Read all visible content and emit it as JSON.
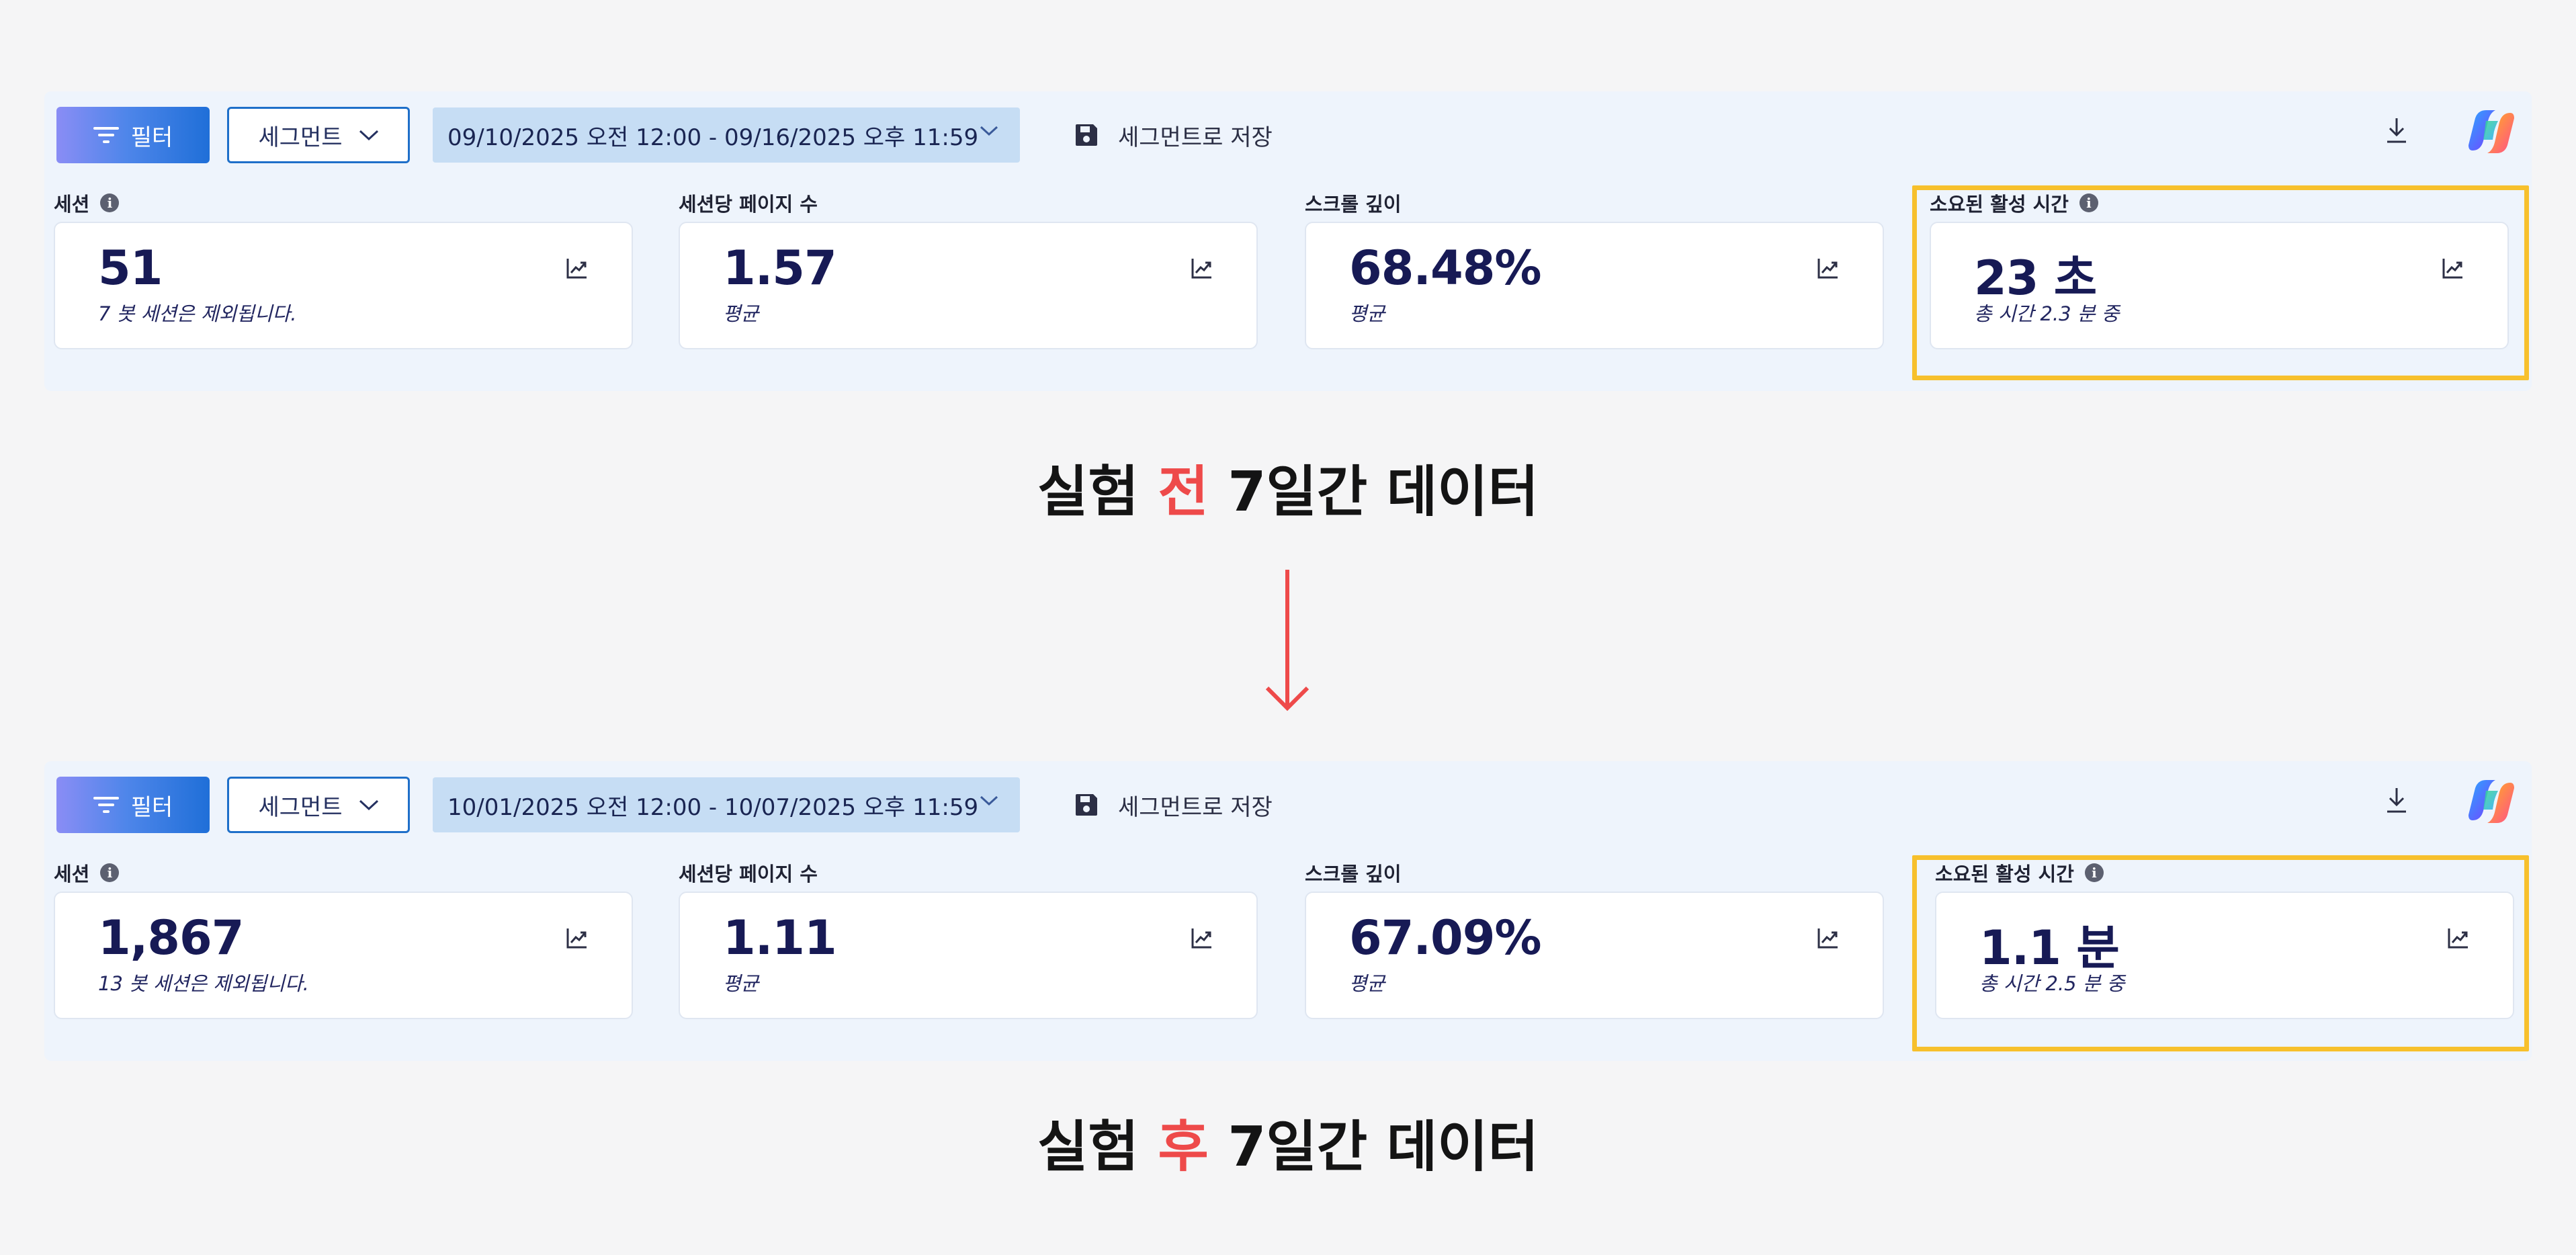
{
  "toolbar": {
    "filter_label": "필터",
    "segment_label": "세그먼트",
    "save_segment_label": "세그먼트로 저장"
  },
  "panels": [
    {
      "date_range": "09/10/2025 오전 12:00 - 09/16/2025 오후 11:59",
      "metrics": [
        {
          "label": "세션",
          "value": "51",
          "sub": "7 봇 세션은 제외됩니다."
        },
        {
          "label": "세션당 페이지 수",
          "value": "1.57",
          "sub": "평균"
        },
        {
          "label": "스크롤 깊이",
          "value": "68.48%",
          "sub": "평균"
        },
        {
          "label": "소요된 활성 시간",
          "value": "23 초",
          "sub": "총 시간 2.3 분 중"
        }
      ],
      "caption": {
        "pre": "실험 ",
        "accent": "전",
        "post": " 7일간 데이터"
      }
    },
    {
      "date_range": "10/01/2025 오전 12:00 - 10/07/2025 오후 11:59",
      "metrics": [
        {
          "label": "세션",
          "value": "1,867",
          "sub": "13 봇 세션은 제외됩니다."
        },
        {
          "label": "세션당 페이지 수",
          "value": "1.11",
          "sub": "평균"
        },
        {
          "label": "스크롤 깊이",
          "value": "67.09%",
          "sub": "평균"
        },
        {
          "label": "소요된 활성 시간",
          "value": "1.1 분",
          "sub": "총 시간 2.5 분 중"
        }
      ],
      "caption": {
        "pre": "실험 ",
        "accent": "후",
        "post": " 7일간 데이터"
      }
    }
  ],
  "colors": {
    "highlight": "#f7c02c",
    "accent_red": "#ee4a4a",
    "panel_bg": "#eef4fc",
    "date_bg": "#c6ddf4",
    "segment_border": "#1e6fc9"
  },
  "icons": [
    "filter-icon",
    "chevron-down-icon",
    "save-icon",
    "download-icon",
    "copilot-icon",
    "info-icon",
    "trend-chart-icon",
    "down-arrow-icon"
  ]
}
